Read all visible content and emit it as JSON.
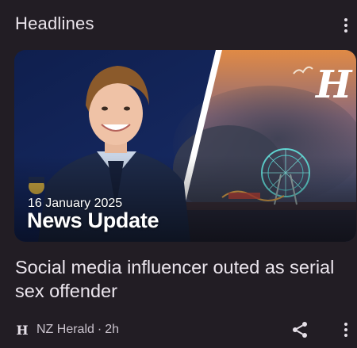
{
  "header": {
    "title": "Headlines"
  },
  "card": {
    "image": {
      "date_text": "16 January 2025",
      "title_text": "News Update",
      "watermark": "H"
    },
    "headline": "Social media influencer outed as serial sex offender",
    "source": {
      "logo": "H",
      "name": "NZ Herald",
      "separator": "·",
      "age": "2h"
    }
  },
  "icons": {
    "more_top": "kebab-vertical-icon",
    "share": "share-icon",
    "more_bottom": "kebab-vertical-icon"
  },
  "colors": {
    "background": "#221d24",
    "text": "#ece6ee",
    "secondary_text": "#c9c2cc"
  }
}
